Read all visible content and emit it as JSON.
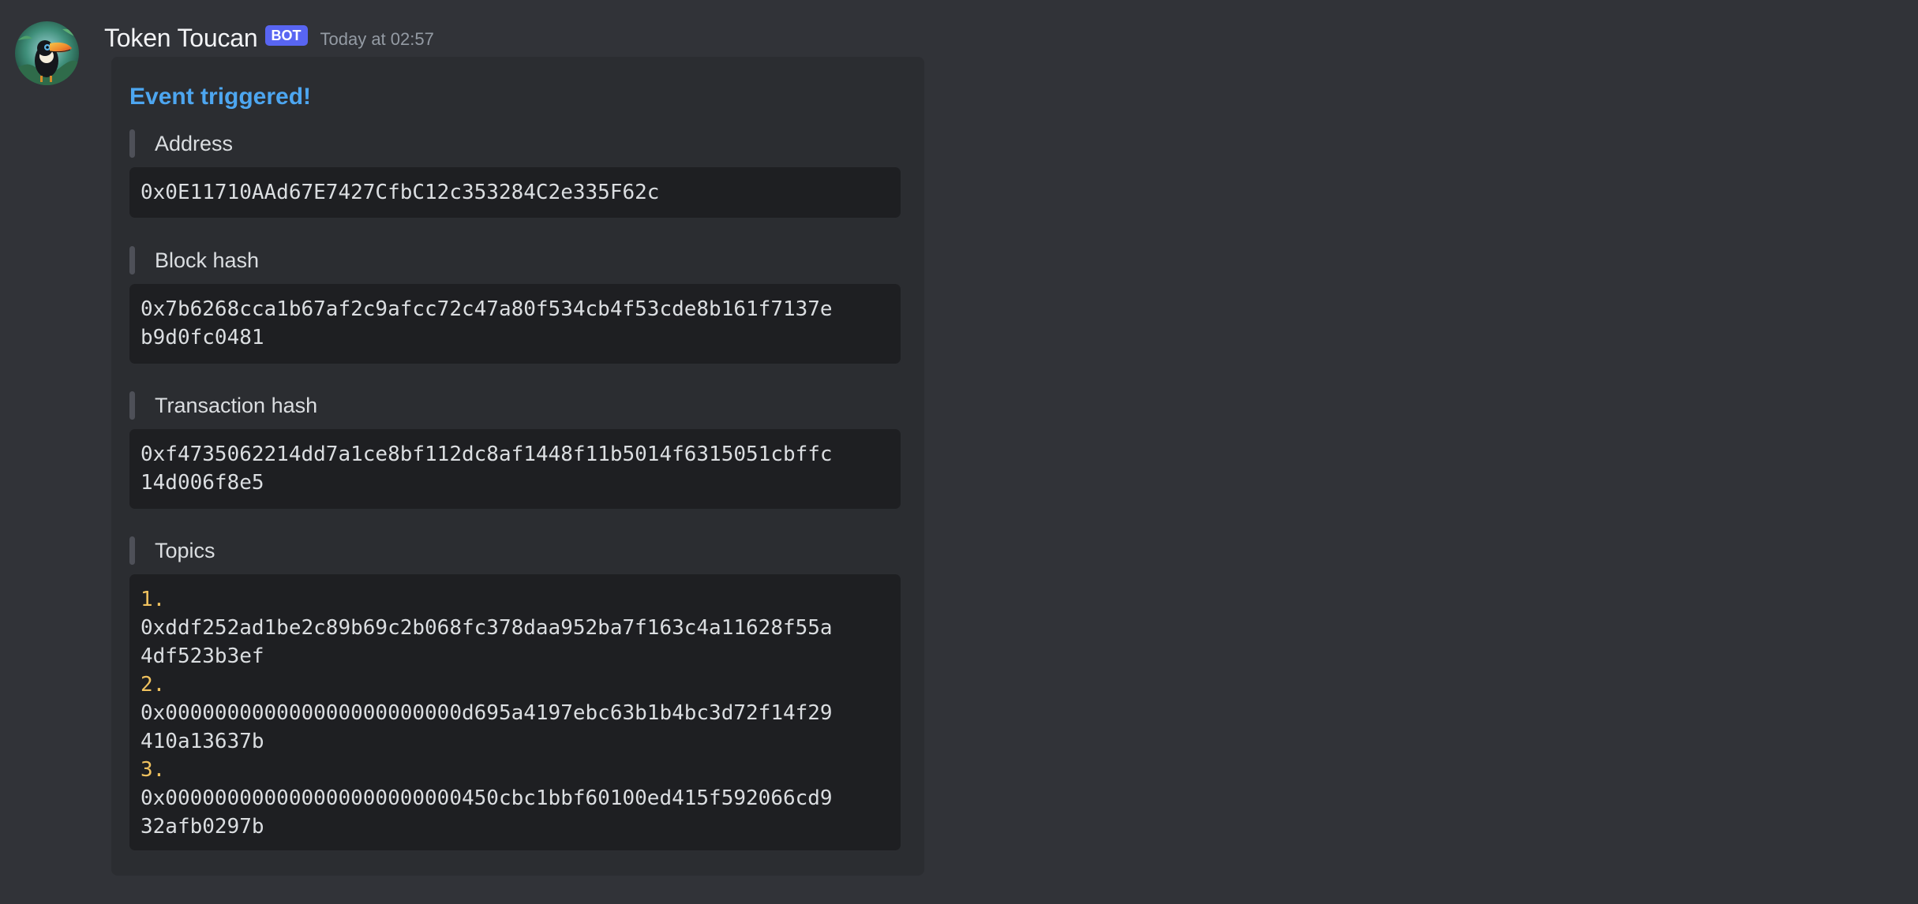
{
  "message": {
    "author": "Token Toucan",
    "bot_tag": "BOT",
    "timestamp": "Today at 02:57",
    "avatar_icon": "toucan-avatar-icon"
  },
  "embed": {
    "title": "Event triggered!",
    "title_color": "#4da6f0",
    "fields": {
      "address": {
        "name": "Address",
        "lines": [
          "0x0E11710AAd67E7427CfbC12c353284C2e335F62c"
        ]
      },
      "block_hash": {
        "name": "Block hash",
        "lines": [
          "0x7b6268cca1b67af2c9afcc72c47a80f534cb4f53cde8b161f7137e",
          "b9d0fc0481"
        ]
      },
      "transaction_hash": {
        "name": "Transaction hash",
        "lines": [
          "0xf4735062214dd7a1ce8bf112dc8af1448f11b5014f6315051cbffc",
          "14d006f8e5"
        ]
      },
      "topics": {
        "name": "Topics",
        "items": [
          {
            "number": "1.",
            "lines": [
              "0xddf252ad1be2c89b69c2b068fc378daa952ba7f163c4a11628f55a",
              "4df523b3ef"
            ]
          },
          {
            "number": "2.",
            "lines": [
              "0x000000000000000000000000d695a4197ebc63b1b4bc3d72f14f29",
              "410a13637b"
            ]
          },
          {
            "number": "3.",
            "lines": [
              "0x000000000000000000000000450cbc1bbf60100ed415f592066cd9",
              "32afb0297b"
            ]
          }
        ]
      }
    }
  },
  "colors": {
    "background": "#313338",
    "embed_background": "#2b2d31",
    "code_background": "#1e1f22",
    "bot_tag": "#5865f2",
    "list_number": "#f0c25f"
  }
}
